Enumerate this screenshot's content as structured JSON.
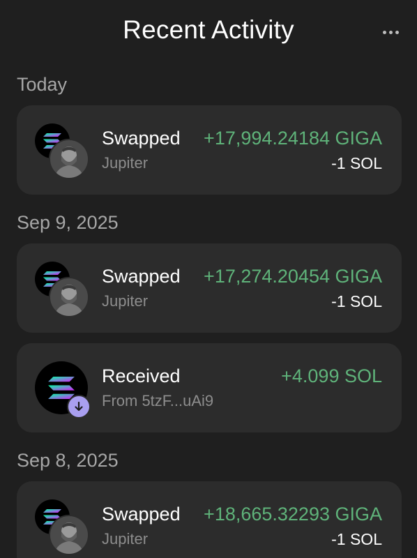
{
  "header": {
    "title": "Recent Activity",
    "more_icon": "more-dots-icon"
  },
  "sections": [
    {
      "label": "Today",
      "items": [
        {
          "title": "Swapped",
          "subtitle": "Jupiter",
          "amount_in": "+17,994.24184 GIGA",
          "amount_out": "-1 SOL",
          "icon": "swap-solana-giga-icon"
        }
      ]
    },
    {
      "label": "Sep 9, 2025",
      "items": [
        {
          "title": "Swapped",
          "subtitle": "Jupiter",
          "amount_in": "+17,274.20454 GIGA",
          "amount_out": "-1 SOL",
          "icon": "swap-solana-giga-icon"
        },
        {
          "title": "Received",
          "subtitle": "From 5tzF...uAi9",
          "amount_in": "+4.099 SOL",
          "icon": "solana-receive-icon"
        }
      ]
    },
    {
      "label": "Sep 8, 2025",
      "items": [
        {
          "title": "Swapped",
          "subtitle": "Jupiter",
          "amount_in": "+18,665.32293 GIGA",
          "amount_out": "-1 SOL",
          "icon": "swap-solana-giga-icon"
        }
      ]
    }
  ],
  "colors": {
    "background": "#1f1f1f",
    "card": "#2c2c2c",
    "positive": "#5fb37a",
    "muted": "#8d8d8d",
    "receive_badge": "#a99ff0"
  }
}
